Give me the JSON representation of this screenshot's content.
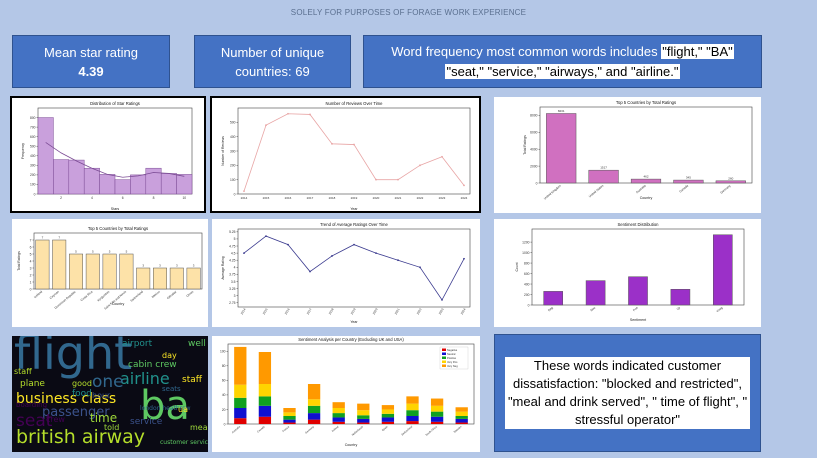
{
  "header": {
    "title": "SOLELY FOR PURPOSES OF FORAGE WORK EXPERIENCE"
  },
  "kpis": {
    "rating_label": "Mean star rating",
    "rating_value": "4.39",
    "countries_label": "Number of unique",
    "countries_value": "countries: 69",
    "words_line1_a": "Word frequency most common words includes ",
    "words_line1_b": "\"flight,\" \"BA\"",
    "words_line2": "\"seat,\" \"service,\" \"airways,\" and \"airline.\""
  },
  "note": {
    "text": "These words indicated customer dissatisfaction: \"blocked and restricted\", \"meal and drink served\", \" time of flight\", \" stressful operator\""
  },
  "wordcloud": {
    "words": [
      "flight",
      "ba",
      "british airway",
      "business class",
      "passenger",
      "airline",
      "seat",
      "time",
      "one",
      "cabin crew",
      "plane",
      "staff",
      "service",
      "food",
      "boarding",
      "meal",
      "london heathrow",
      "customer service",
      "good",
      "day",
      "hour",
      "airport",
      "crew",
      "told",
      "seats",
      "well",
      "staff",
      "ua"
    ],
    "colors": [
      "#31688e",
      "#5ec962",
      "#b5de2b",
      "#fde725",
      "#3b528b",
      "#21918c",
      "#440154",
      "#9fda3a"
    ]
  },
  "chart_data": [
    {
      "type": "bar",
      "title": "Distribution of Star Ratings",
      "xlabel": "Stars",
      "ylabel": "Frequency",
      "color": "#c9a0dc",
      "edge": "#7b4b94",
      "categories": [
        1,
        2,
        3,
        4,
        5,
        6,
        7,
        8,
        9,
        10
      ],
      "values": [
        800,
        360,
        355,
        270,
        205,
        150,
        200,
        270,
        215,
        205
      ],
      "kde": [
        540,
        430,
        345,
        270,
        205,
        175,
        190,
        225,
        215,
        185
      ],
      "ylim": [
        0,
        900
      ],
      "yticks": [
        0,
        100,
        200,
        300,
        400,
        500,
        600,
        700,
        800
      ],
      "xticks": [
        2,
        4,
        6,
        8,
        10
      ]
    },
    {
      "type": "line",
      "title": "Number of Reviews Over Time",
      "xlabel": "Year",
      "ylabel": "Number of Reviews",
      "color": "#e8a5a5",
      "x": [
        2014,
        2015,
        2016,
        2017,
        2018,
        2019,
        2020,
        2021,
        2022,
        2023,
        2024
      ],
      "values": [
        20,
        480,
        560,
        555,
        350,
        345,
        100,
        100,
        200,
        260,
        60
      ],
      "ylim": [
        0,
        600
      ],
      "yticks": [
        0,
        100,
        200,
        300,
        400,
        500
      ]
    },
    {
      "type": "bar",
      "title": "Top 5 Countries by Total Ratings",
      "xlabel": "Country",
      "ylabel": "Total Ratings",
      "color": "#d070c0",
      "categories": [
        "United Kingdom",
        "United States",
        "Australia",
        "Canada",
        "Germany"
      ],
      "values": [
        8231,
        1517,
        462,
        345,
        260
      ],
      "labels": [
        "8231",
        "1517",
        "462",
        "345",
        "260"
      ],
      "ylim": [
        0,
        9000
      ],
      "yticks": [
        0,
        2000,
        4000,
        6000,
        8000
      ]
    },
    {
      "type": "bar",
      "title": "Top 5 Countries by Total Ratings",
      "xlabel": "Country",
      "ylabel": "Total Ratings",
      "color": "#fde2a8",
      "categories": [
        "Iceland",
        "Cayman",
        "Dominican Republic",
        "Costa Rica",
        "Kyrgyzstan",
        "Saint Kitts and Nevis",
        "Switzerland",
        "Mexico",
        "Gibraltar",
        "Oman"
      ],
      "values": [
        7,
        7,
        5,
        5,
        5,
        5,
        3,
        3,
        3,
        3
      ],
      "labels": [
        "7",
        "7",
        "5",
        "5",
        "5",
        "5",
        "3",
        "3",
        "3",
        "3"
      ],
      "ylim": [
        0,
        8
      ],
      "yticks": [
        0,
        1,
        2,
        3,
        4,
        5,
        6,
        7
      ]
    },
    {
      "type": "line",
      "title": "Trend of Average Ratings Over Time",
      "xlabel": "Year",
      "ylabel": "Average Rating",
      "color": "#3b3b8f",
      "x": [
        2014,
        2015,
        2016,
        2017,
        2018,
        2019,
        2020,
        2021,
        2022,
        2023,
        2024
      ],
      "values": [
        4.5,
        5.1,
        4.8,
        3.85,
        4.4,
        4.8,
        4.5,
        4.25,
        4.0,
        2.85,
        4.3
      ],
      "ylim": [
        2.6,
        5.35
      ],
      "yticks": [
        2.75,
        3.0,
        3.25,
        3.5,
        3.75,
        4.0,
        4.25,
        4.5,
        4.75,
        5.0,
        5.25
      ]
    },
    {
      "type": "bar",
      "title": "Sentiment Distribution",
      "xlabel": "Sentiment",
      "ylabel": "Count",
      "color": "#9b30c8",
      "categories": [
        "Neg",
        "Neu",
        "Pos",
        "Vp",
        "Vneg"
      ],
      "values": [
        260,
        465,
        540,
        300,
        1340
      ],
      "ylim": [
        0,
        1450
      ],
      "yticks": [
        0,
        200,
        400,
        600,
        800,
        1000,
        1200
      ]
    },
    {
      "type": "stacked_bar",
      "title": "Sentiment Analysis per Country (Excluding UK and USA)",
      "xlabel": "Country",
      "categories": [
        "Australia",
        "Canada",
        "France",
        "Germany",
        "Ireland",
        "Netherlands",
        "Spain",
        "Switzerland",
        "South Africa",
        "Sweden"
      ],
      "series": [
        {
          "name": "Negative",
          "color": "#e00000",
          "values": [
            8,
            10,
            2,
            6,
            3,
            2,
            3,
            4,
            3,
            2
          ]
        },
        {
          "name": "Neutral",
          "color": "#1010d0",
          "values": [
            14,
            15,
            4,
            9,
            6,
            5,
            6,
            7,
            7,
            5
          ]
        },
        {
          "name": "Positive",
          "color": "#10a020",
          "values": [
            14,
            13,
            5,
            10,
            6,
            5,
            5,
            8,
            7,
            4
          ]
        },
        {
          "name": "Very Pos",
          "color": "#ffd400",
          "values": [
            18,
            17,
            5,
            9,
            7,
            7,
            6,
            9,
            8,
            6
          ]
        },
        {
          "name": "Very Neg",
          "color": "#ff9900",
          "values": [
            52,
            44,
            6,
            21,
            8,
            9,
            6,
            10,
            10,
            6
          ]
        }
      ],
      "ylim": [
        0,
        110
      ],
      "yticks": [
        0,
        20,
        40,
        60,
        80,
        100
      ]
    }
  ]
}
